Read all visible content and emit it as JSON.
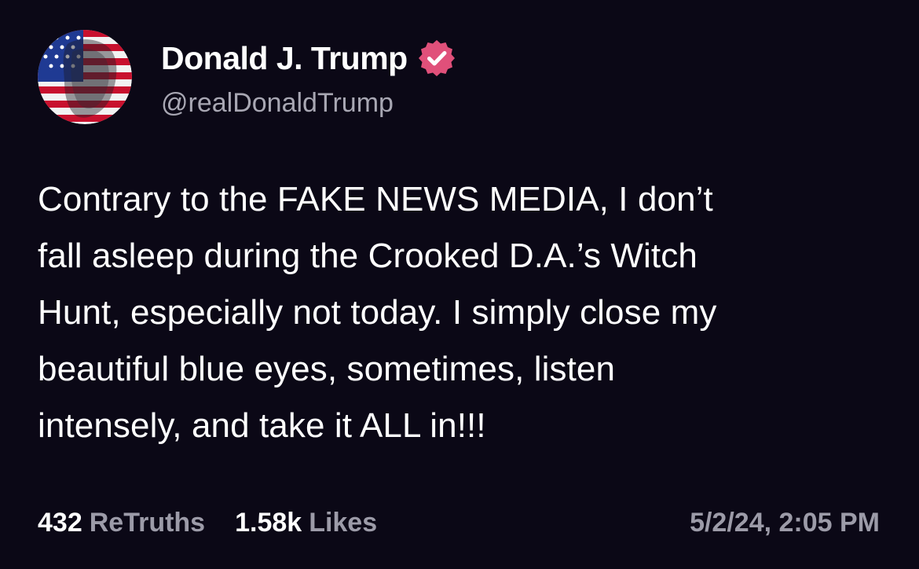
{
  "post": {
    "author": {
      "display_name": "Donald J. Trump",
      "handle": "@realDonaldTrump",
      "verified": true,
      "avatar_icon": "flag-portrait-avatar",
      "verified_icon": "verified-badge-icon"
    },
    "text": "Contrary to the FAKE NEWS MEDIA, I don’t\nfall asleep during the Crooked D.A.’s Witch\nHunt, especially not today. I simply close my\nbeautiful blue eyes, sometimes, listen\nintensely, and take it ALL in!!!",
    "stats": {
      "retruths_count": "432",
      "retruths_label": "ReTruths",
      "likes_count": "1.58k",
      "likes_label": "Likes"
    },
    "timestamp": "5/2/24, 2:05 PM"
  },
  "colors": {
    "background": "#0b0816",
    "primary_text": "#ffffff",
    "secondary_text": "#9c9ba8",
    "verified_badge": "#e0507a",
    "flag_red": "#c8102e",
    "flag_blue": "#1f3a93"
  }
}
